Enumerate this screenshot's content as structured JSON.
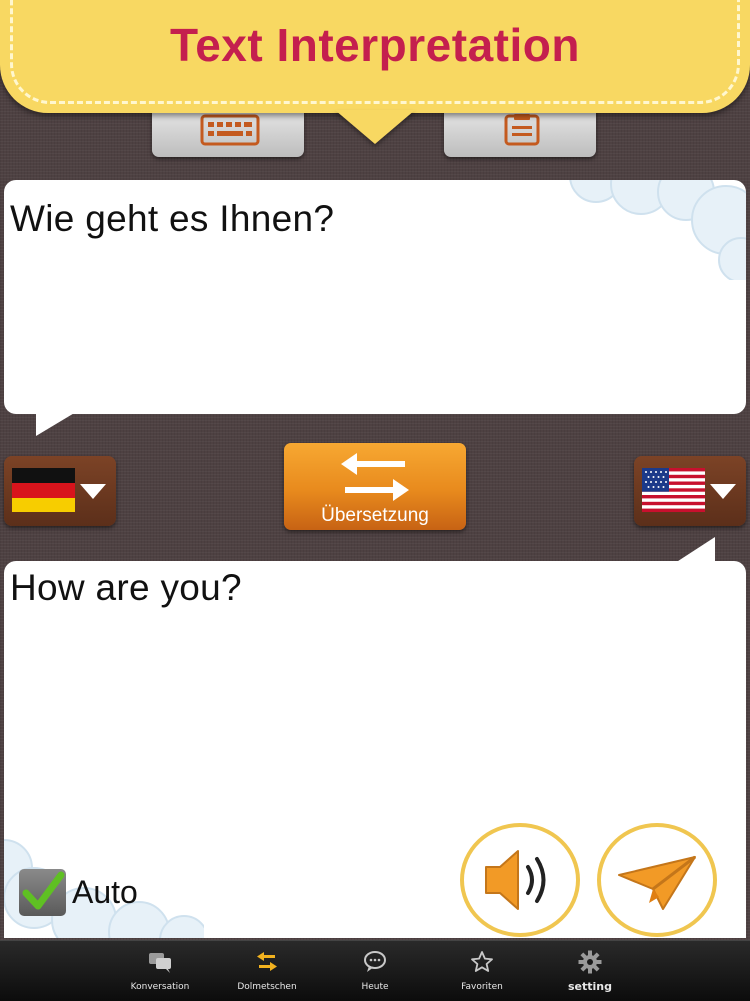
{
  "header": {
    "title": "Text Interpretation"
  },
  "mode_buttons": [
    {
      "name": "keyboard",
      "icon": "keyboard-icon"
    },
    {
      "name": "clipboard",
      "icon": "clipboard-icon"
    }
  ],
  "source": {
    "text": "Wie geht es Ihnen?",
    "language_flag": "german-flag-icon"
  },
  "target": {
    "text": "How are you?",
    "language_flag": "us-flag-icon"
  },
  "translate_button": {
    "label": "Übersetzung",
    "icon": "swap-arrows-icon"
  },
  "auto": {
    "label": "Auto",
    "checked": true
  },
  "actions": {
    "speak_icon": "speaker-icon",
    "send_icon": "paper-plane-icon"
  },
  "tabbar": {
    "tabs": [
      {
        "label": "Konversation",
        "icon": "chat-bubbles-icon"
      },
      {
        "label": "Dolmetschen",
        "icon": "swap-arrows-icon"
      },
      {
        "label": "Heute",
        "icon": "speech-bubble-icon"
      },
      {
        "label": "Favoriten",
        "icon": "star-icon"
      },
      {
        "label": "setting",
        "icon": "gear-icon"
      }
    ]
  },
  "colors": {
    "banner": "#f8d862",
    "title": "#c41f4e",
    "accent_orange": "#f29a26",
    "background": "#4e4142"
  }
}
